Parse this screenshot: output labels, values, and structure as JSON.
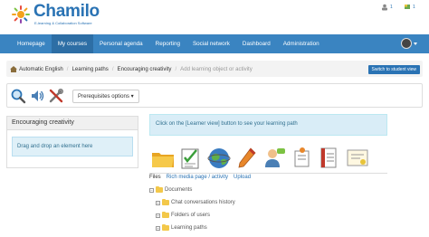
{
  "brand": {
    "name": "Chamilo",
    "tagline": "E-learning & Collaboration Software",
    "colors": {
      "primary": "#2a73b4",
      "navbar": "#3a84c1",
      "navbar_active": "#2d6ea5",
      "info": "#d9edf7"
    }
  },
  "top_icons": [
    {
      "icon": "inbox-icon",
      "count": "1"
    },
    {
      "icon": "flag-icon",
      "count": "1"
    }
  ],
  "nav": {
    "items": [
      {
        "label": "Homepage"
      },
      {
        "label": "My courses"
      },
      {
        "label": "Personal agenda"
      },
      {
        "label": "Reporting"
      },
      {
        "label": "Social network"
      },
      {
        "label": "Dashboard"
      },
      {
        "label": "Administration"
      }
    ],
    "active": "My courses"
  },
  "breadcrumb": {
    "items": [
      "Automatic English",
      "Learning paths",
      "Encouraging creativity",
      "Add learning object or activity"
    ],
    "switch_label": "Switch to student view"
  },
  "toolbar": {
    "icons": [
      "search-icon",
      "audio-icon",
      "settings-tools-icon"
    ],
    "prerequisites_label": "Prerequisites options ▾"
  },
  "left_panel": {
    "title": "Encouraging creativity",
    "drop_text": "Drag and drop an element here"
  },
  "info_text": "Click on the [Learner view] button to see your learning path",
  "tool_icons": [
    "documents-folder-icon",
    "quiz-icon",
    "links-globe-icon",
    "assignment-pen-icon",
    "forum-users-icon",
    "survey-icon",
    "exam-icon",
    "certificate-icon"
  ],
  "tabs": [
    {
      "label": "Files",
      "active": true
    },
    {
      "label": "Rich media page / activity",
      "active": false
    },
    {
      "label": "Upload",
      "active": false
    }
  ],
  "tree": {
    "root": "Documents",
    "children": [
      "Chat conversations history",
      "Folders of users",
      "Learning paths"
    ]
  }
}
